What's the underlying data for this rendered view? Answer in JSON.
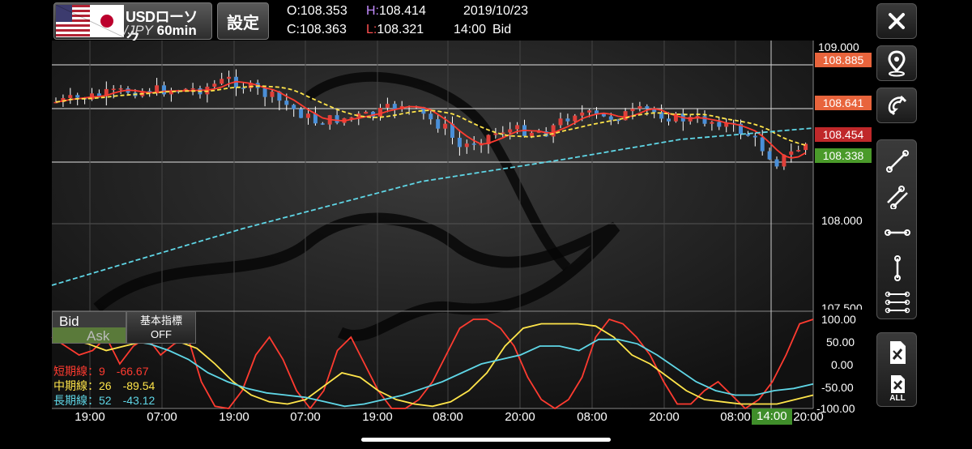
{
  "header": {
    "pair_top": "USDローソク",
    "pair_bottom_quote": "/JPY",
    "pair_bottom_interval": "60min",
    "settings_label": "設定",
    "open_label": "O:",
    "open_value": "108.353",
    "high_label": "H:",
    "high_value": "108.414",
    "date": "2019/10/23",
    "close_label": "C:",
    "close_value": "108.363",
    "low_label": "L:",
    "low_value": "108.321",
    "time": "14:00",
    "side": "Bid"
  },
  "price_axis": {
    "labels": [
      "109.000",
      "108.000",
      "107.500"
    ],
    "tags": [
      {
        "value": "108.885",
        "color": "#e8643c"
      },
      {
        "value": "108.641",
        "color": "#e8643c"
      },
      {
        "value": "108.454",
        "color": "#c0282a"
      },
      {
        "value": "108.338",
        "color": "#4a9a2a"
      }
    ]
  },
  "sub_panel": {
    "bid_label": "Bid",
    "ask_label": "Ask",
    "indicator_label": "基本指標",
    "indicator_state": "OFF",
    "axis_labels": [
      "100.00",
      "50.00",
      "0.00",
      "-50.00",
      "-100.00"
    ],
    "legend": [
      {
        "name": "短期線：9",
        "value": "-66.67",
        "color": "#ff3b30"
      },
      {
        "name": "中期線：26",
        "value": "-89.54",
        "color": "#ffe54a"
      },
      {
        "name": "長期線：52",
        "value": "-43.12",
        "color": "#5fd6e6"
      }
    ]
  },
  "time_axis": {
    "labels": [
      "19:00",
      "07:00",
      "19:00",
      "07:00",
      "19:00",
      "08:00",
      "20:00",
      "08:00",
      "20:00",
      "08:00",
      "20:00"
    ],
    "current": "14:00"
  },
  "toolbar": {
    "icons": [
      "close-icon",
      "map-pin-icon",
      "magnet-icon",
      "trend-line-icon",
      "parallel-lines-icon",
      "horizontal-line-icon",
      "vertical-line-icon",
      "fibonacci-lines-icon",
      "delete-drawing-icon",
      "delete-all-drawings-icon"
    ],
    "all_label": "ALL"
  },
  "colors": {
    "short_ma": "#ff3b30",
    "mid_ma": "#ffe54a",
    "long_ma": "#5fd6e6",
    "up_candle": "#e0403a",
    "down_candle": "#4a8fd8"
  }
}
